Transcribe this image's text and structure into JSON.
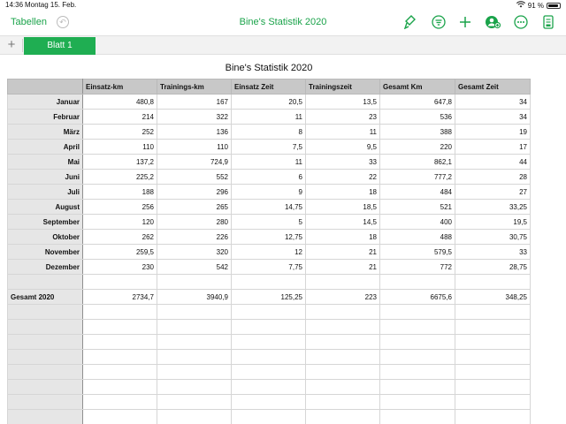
{
  "status": {
    "time": "14:36",
    "date": "Montag 15. Feb.",
    "battery_label": "91 %",
    "battery_level": 0.91
  },
  "toolbar": {
    "back_label": "Tabellen",
    "doc_title": "Bine's Statistik 2020",
    "icons": [
      "undo-icon",
      "format-brush-icon",
      "filter-icon",
      "add-icon",
      "collaborate-icon",
      "more-icon",
      "document-icon"
    ]
  },
  "sheets": {
    "add_label": "+",
    "active_tab": "Blatt 1"
  },
  "table": {
    "title": "Bine's Statistik 2020",
    "headers": [
      "",
      "Einsatz-km",
      "Trainings-km",
      "Einsatz Zeit",
      "Trainingszeit",
      "Gesamt Km",
      "Gesamt  Zeit"
    ],
    "rows": [
      [
        "Januar",
        "480,8",
        "167",
        "20,5",
        "13,5",
        "647,8",
        "34"
      ],
      [
        "Februar",
        "214",
        "322",
        "11",
        "23",
        "536",
        "34"
      ],
      [
        "März",
        "252",
        "136",
        "8",
        "11",
        "388",
        "19"
      ],
      [
        "April",
        "110",
        "110",
        "7,5",
        "9,5",
        "220",
        "17"
      ],
      [
        "Mai",
        "137,2",
        "724,9",
        "11",
        "33",
        "862,1",
        "44"
      ],
      [
        "Juni",
        "225,2",
        "552",
        "6",
        "22",
        "777,2",
        "28"
      ],
      [
        "Juli",
        "188",
        "296",
        "9",
        "18",
        "484",
        "27"
      ],
      [
        "August",
        "256",
        "265",
        "14,75",
        "18,5",
        "521",
        "33,25"
      ],
      [
        "September",
        "120",
        "280",
        "5",
        "14,5",
        "400",
        "19,5"
      ],
      [
        "Oktober",
        "262",
        "226",
        "12,75",
        "18",
        "488",
        "30,75"
      ],
      [
        "November",
        "259,5",
        "320",
        "12",
        "21",
        "579,5",
        "33"
      ],
      [
        "Dezember",
        "230",
        "542",
        "7,75",
        "21",
        "772",
        "28,75"
      ],
      [
        "",
        "",
        "",
        "",
        "",
        "",
        ""
      ],
      [
        "Gesamt 2020",
        "2734,7",
        "3940,9",
        "125,25",
        "223",
        "6675,6",
        "348,25"
      ],
      [
        "",
        "",
        "",
        "",
        "",
        "",
        ""
      ],
      [
        "",
        "",
        "",
        "",
        "",
        "",
        ""
      ],
      [
        "",
        "",
        "",
        "",
        "",
        "",
        ""
      ],
      [
        "",
        "",
        "",
        "",
        "",
        "",
        ""
      ],
      [
        "",
        "",
        "",
        "",
        "",
        "",
        ""
      ],
      [
        "",
        "",
        "",
        "",
        "",
        "",
        ""
      ],
      [
        "",
        "",
        "",
        "",
        "",
        "",
        ""
      ],
      [
        "",
        "",
        "",
        "",
        "",
        "",
        ""
      ]
    ]
  },
  "colors": {
    "accent": "#1aa34a",
    "tab_active": "#1fae52",
    "header_bg": "#c8c8c8",
    "rowheader_bg": "#e6e6e6"
  }
}
